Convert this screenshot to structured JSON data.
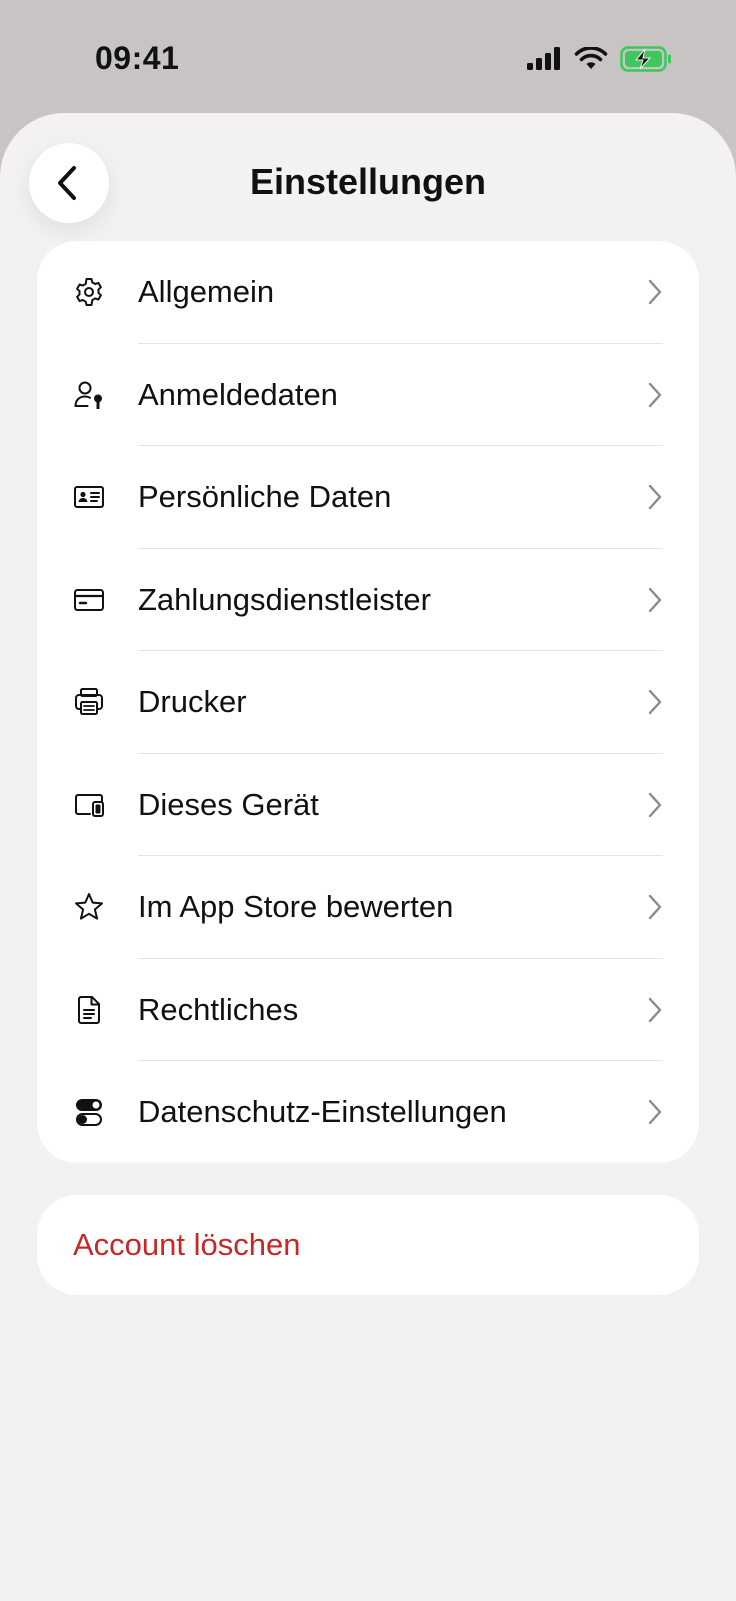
{
  "status_bar": {
    "time": "09:41",
    "icons": [
      "cellular-signal-icon",
      "wifi-icon",
      "battery-charging-icon"
    ],
    "battery_color": "#3cc85a"
  },
  "header": {
    "title": "Einstellungen",
    "back_icon": "chevron-left-icon"
  },
  "menu": {
    "items": [
      {
        "label": "Allgemein",
        "icon": "gear-icon"
      },
      {
        "label": "Anmeldedaten",
        "icon": "user-key-icon"
      },
      {
        "label": "Persönliche Daten",
        "icon": "id-card-icon"
      },
      {
        "label": "Zahlungsdienstleister",
        "icon": "credit-card-icon"
      },
      {
        "label": "Drucker",
        "icon": "printer-icon"
      },
      {
        "label": "Dieses Gerät",
        "icon": "devices-icon"
      },
      {
        "label": "Im App Store bewerten",
        "icon": "star-icon"
      },
      {
        "label": "Rechtliches",
        "icon": "document-icon"
      },
      {
        "label": "Datenschutz-Einstellungen",
        "icon": "toggles-icon"
      }
    ]
  },
  "danger": {
    "delete_account_label": "Account löschen",
    "color": "#c62828"
  }
}
